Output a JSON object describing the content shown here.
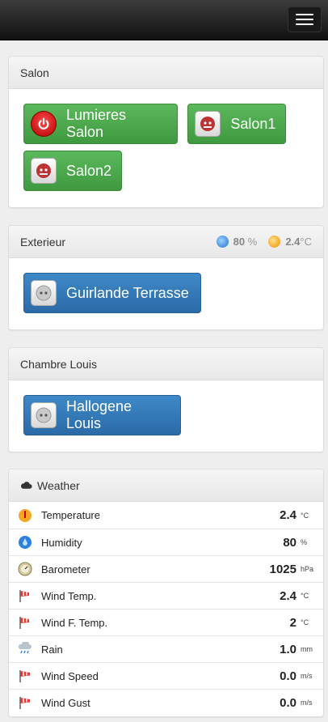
{
  "nav": {
    "toggle_icon": "menu-icon"
  },
  "rooms": [
    {
      "title": "Salon",
      "devices": [
        {
          "label": "Lumieres Salon",
          "icon": "power-icon",
          "color": "#4cae4c"
        },
        {
          "label": "Salon1",
          "icon": "socket-on-icon",
          "color": "#4cae4c"
        },
        {
          "label": "Salon2",
          "icon": "socket-on-icon",
          "color": "#4cae4c"
        }
      ]
    },
    {
      "title": "Exterieur",
      "humidity": {
        "value": "80",
        "unit": "%"
      },
      "temperature": {
        "value": "2.4",
        "unit": "°C"
      },
      "devices": [
        {
          "label": "Guirlande Terrasse",
          "icon": "socket-off-icon",
          "color": "#337ab7"
        }
      ]
    },
    {
      "title": "Chambre Louis",
      "devices": [
        {
          "label": "Hallogene Louis",
          "icon": "socket-off-icon",
          "color": "#337ab7"
        }
      ]
    }
  ],
  "weather": {
    "title": "Weather",
    "icon": "cloud-icon",
    "rows": [
      {
        "label": "Temperature",
        "value": "2.4",
        "unit": "°C",
        "icon": "thermometer-icon"
      },
      {
        "label": "Humidity",
        "value": "80",
        "unit": "%",
        "icon": "humidity-icon"
      },
      {
        "label": "Barometer",
        "value": "1025",
        "unit": "hPa",
        "icon": "barometer-icon"
      },
      {
        "label": "Wind Temp.",
        "value": "2.4",
        "unit": "°C",
        "icon": "wind-temp-icon"
      },
      {
        "label": "Wind F. Temp.",
        "value": "2",
        "unit": "°C",
        "icon": "wind-feel-icon"
      },
      {
        "label": "Rain",
        "value": "1.0",
        "unit": "mm",
        "icon": "rain-icon"
      },
      {
        "label": "Wind Speed",
        "value": "0.0",
        "unit": "m/s",
        "icon": "windsock-icon"
      },
      {
        "label": "Wind Gust",
        "value": "0.0",
        "unit": "m/s",
        "icon": "windsock-icon"
      }
    ]
  }
}
